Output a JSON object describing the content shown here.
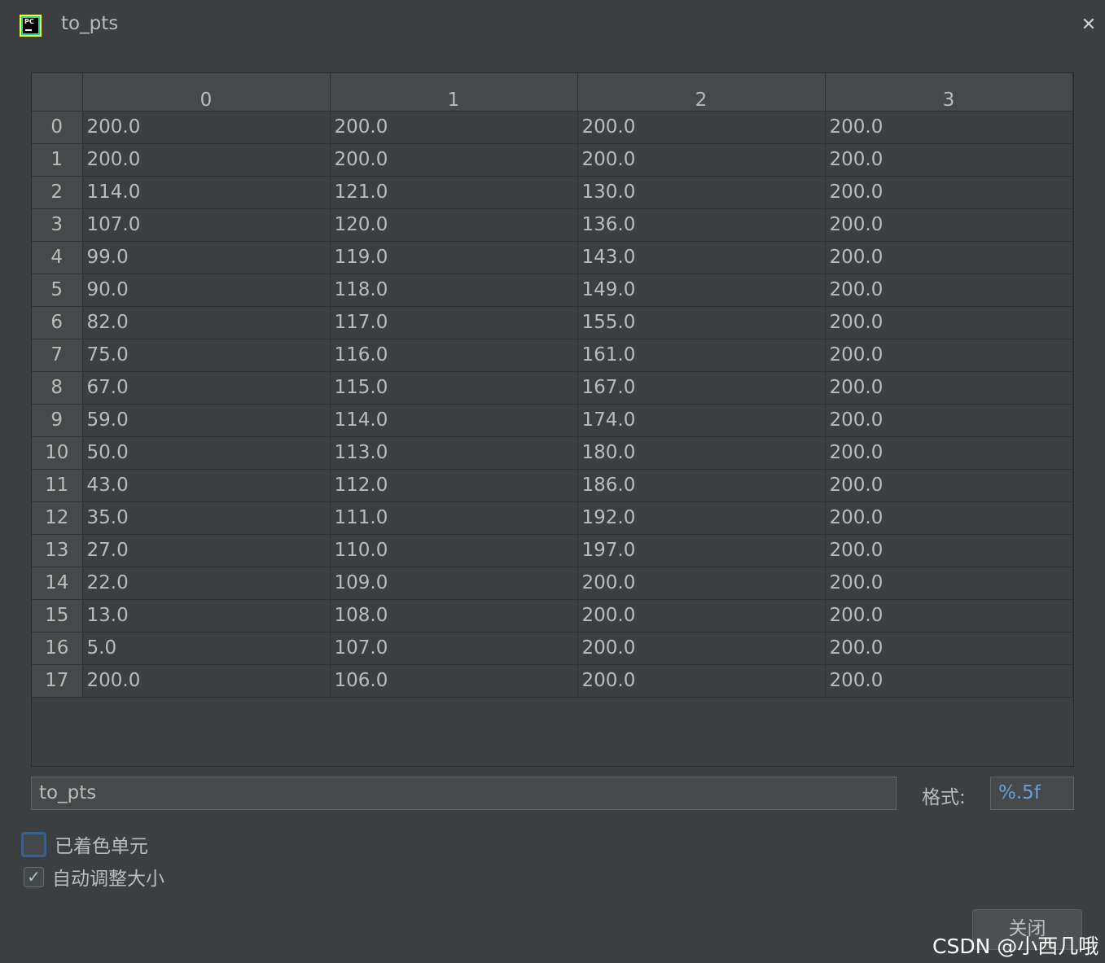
{
  "window": {
    "title": "to_pts",
    "app_icon": "pycharm-icon",
    "close_icon": "close-icon",
    "close_glyph": "✕"
  },
  "table": {
    "columns": [
      "0",
      "1",
      "2",
      "3"
    ],
    "rows": [
      {
        "index": "0",
        "cells": [
          "200.0",
          "200.0",
          "200.0",
          "200.0"
        ]
      },
      {
        "index": "1",
        "cells": [
          "200.0",
          "200.0",
          "200.0",
          "200.0"
        ]
      },
      {
        "index": "2",
        "cells": [
          "114.0",
          "121.0",
          "130.0",
          "200.0"
        ]
      },
      {
        "index": "3",
        "cells": [
          "107.0",
          "120.0",
          "136.0",
          "200.0"
        ]
      },
      {
        "index": "4",
        "cells": [
          "99.0",
          "119.0",
          "143.0",
          "200.0"
        ]
      },
      {
        "index": "5",
        "cells": [
          "90.0",
          "118.0",
          "149.0",
          "200.0"
        ]
      },
      {
        "index": "6",
        "cells": [
          "82.0",
          "117.0",
          "155.0",
          "200.0"
        ]
      },
      {
        "index": "7",
        "cells": [
          "75.0",
          "116.0",
          "161.0",
          "200.0"
        ]
      },
      {
        "index": "8",
        "cells": [
          "67.0",
          "115.0",
          "167.0",
          "200.0"
        ]
      },
      {
        "index": "9",
        "cells": [
          "59.0",
          "114.0",
          "174.0",
          "200.0"
        ]
      },
      {
        "index": "10",
        "cells": [
          "50.0",
          "113.0",
          "180.0",
          "200.0"
        ]
      },
      {
        "index": "11",
        "cells": [
          "43.0",
          "112.0",
          "186.0",
          "200.0"
        ]
      },
      {
        "index": "12",
        "cells": [
          "35.0",
          "111.0",
          "192.0",
          "200.0"
        ]
      },
      {
        "index": "13",
        "cells": [
          "27.0",
          "110.0",
          "197.0",
          "200.0"
        ]
      },
      {
        "index": "14",
        "cells": [
          "22.0",
          "109.0",
          "200.0",
          "200.0"
        ]
      },
      {
        "index": "15",
        "cells": [
          "13.0",
          "108.0",
          "200.0",
          "200.0"
        ]
      },
      {
        "index": "16",
        "cells": [
          "5.0",
          "107.0",
          "200.0",
          "200.0"
        ]
      },
      {
        "index": "17",
        "cells": [
          "200.0",
          "106.0",
          "200.0",
          "200.0"
        ]
      }
    ]
  },
  "footer": {
    "name_value": "to_pts",
    "format_label": "格式:",
    "format_value": "%.5f",
    "colored_cells_label": "已着色单元",
    "colored_cells_checked": false,
    "auto_resize_label": "自动调整大小",
    "auto_resize_checked": true,
    "check_glyph": "✓",
    "close_button_label": "关闭"
  },
  "watermark": "CSDN @小西几哦",
  "colors": {
    "background": "#3c3f41",
    "header": "#45494a",
    "text": "#bbbbbb",
    "format_accent": "#6a9fd5"
  }
}
